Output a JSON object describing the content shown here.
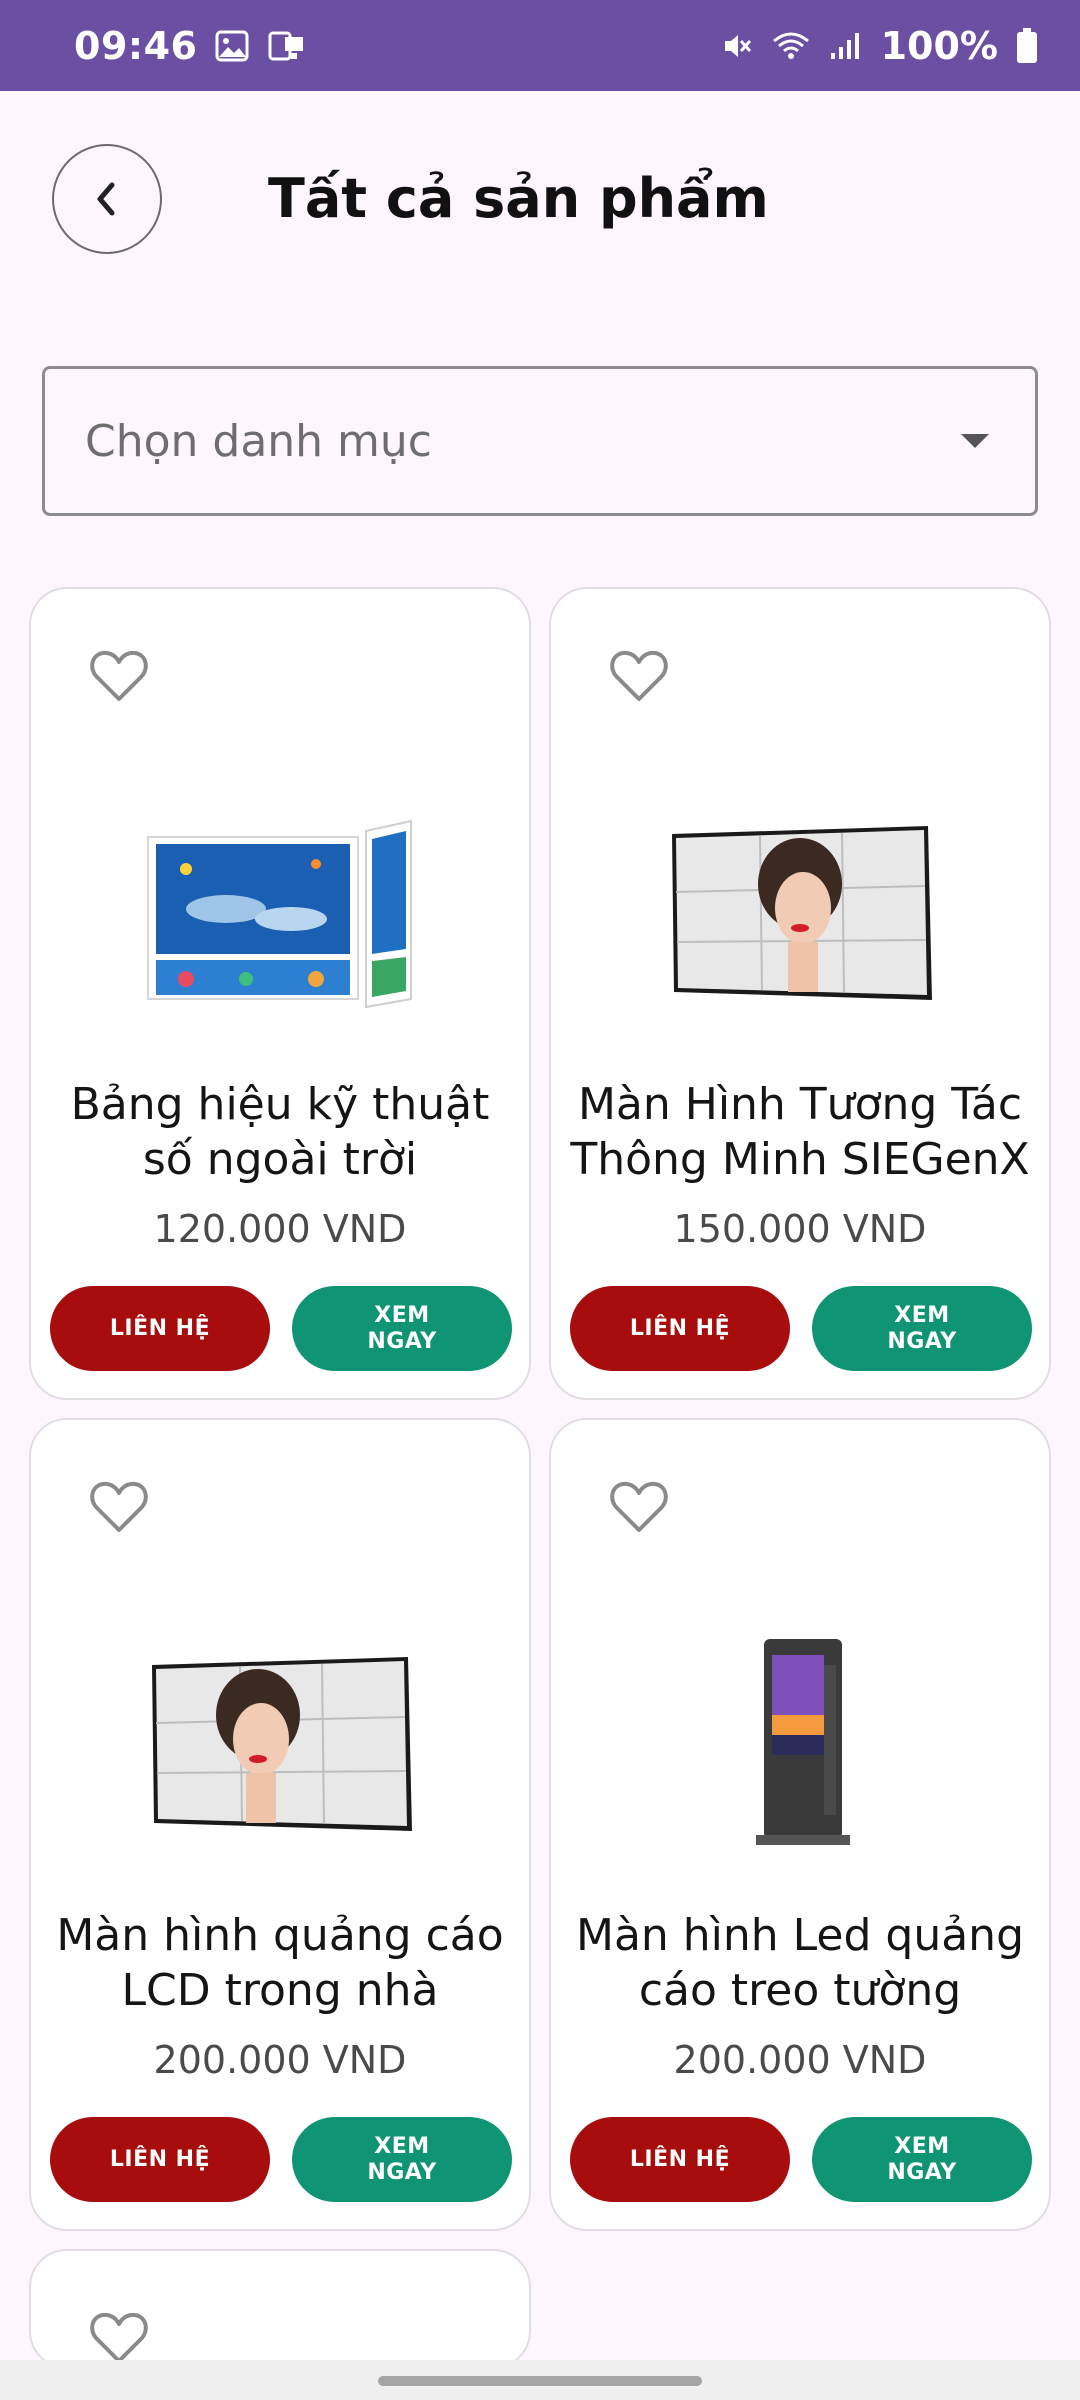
{
  "status_bar": {
    "time": "09:46",
    "battery": "100%"
  },
  "header": {
    "title": "Tất cả sản phẩm"
  },
  "filter": {
    "placeholder": "Chọn danh mục"
  },
  "buttons": {
    "contact": "LIÊN HỆ",
    "view_line1": "XEM",
    "view_line2": "NGAY"
  },
  "products": [
    {
      "name": "Bảng hiệu kỹ thuật số ngoài trời",
      "price": "120.000 VND",
      "image": "outdoor-digital-signage"
    },
    {
      "name": "Màn Hình Tương Tác Thông Minh SIEGenX",
      "price": "150.000 VND",
      "image": "video-wall-portrait"
    },
    {
      "name": "Màn hình quảng cáo LCD trong nhà",
      "price": "200.000 VND",
      "image": "video-wall-portrait"
    },
    {
      "name": "Màn hình Led quảng cáo treo tường",
      "price": "200.000 VND",
      "image": "standing-kiosk"
    }
  ],
  "colors": {
    "status_bar": "#6a4fa3",
    "contact_button": "#a80d0d",
    "view_button": "#0f9573",
    "background": "#fdf6fd"
  }
}
